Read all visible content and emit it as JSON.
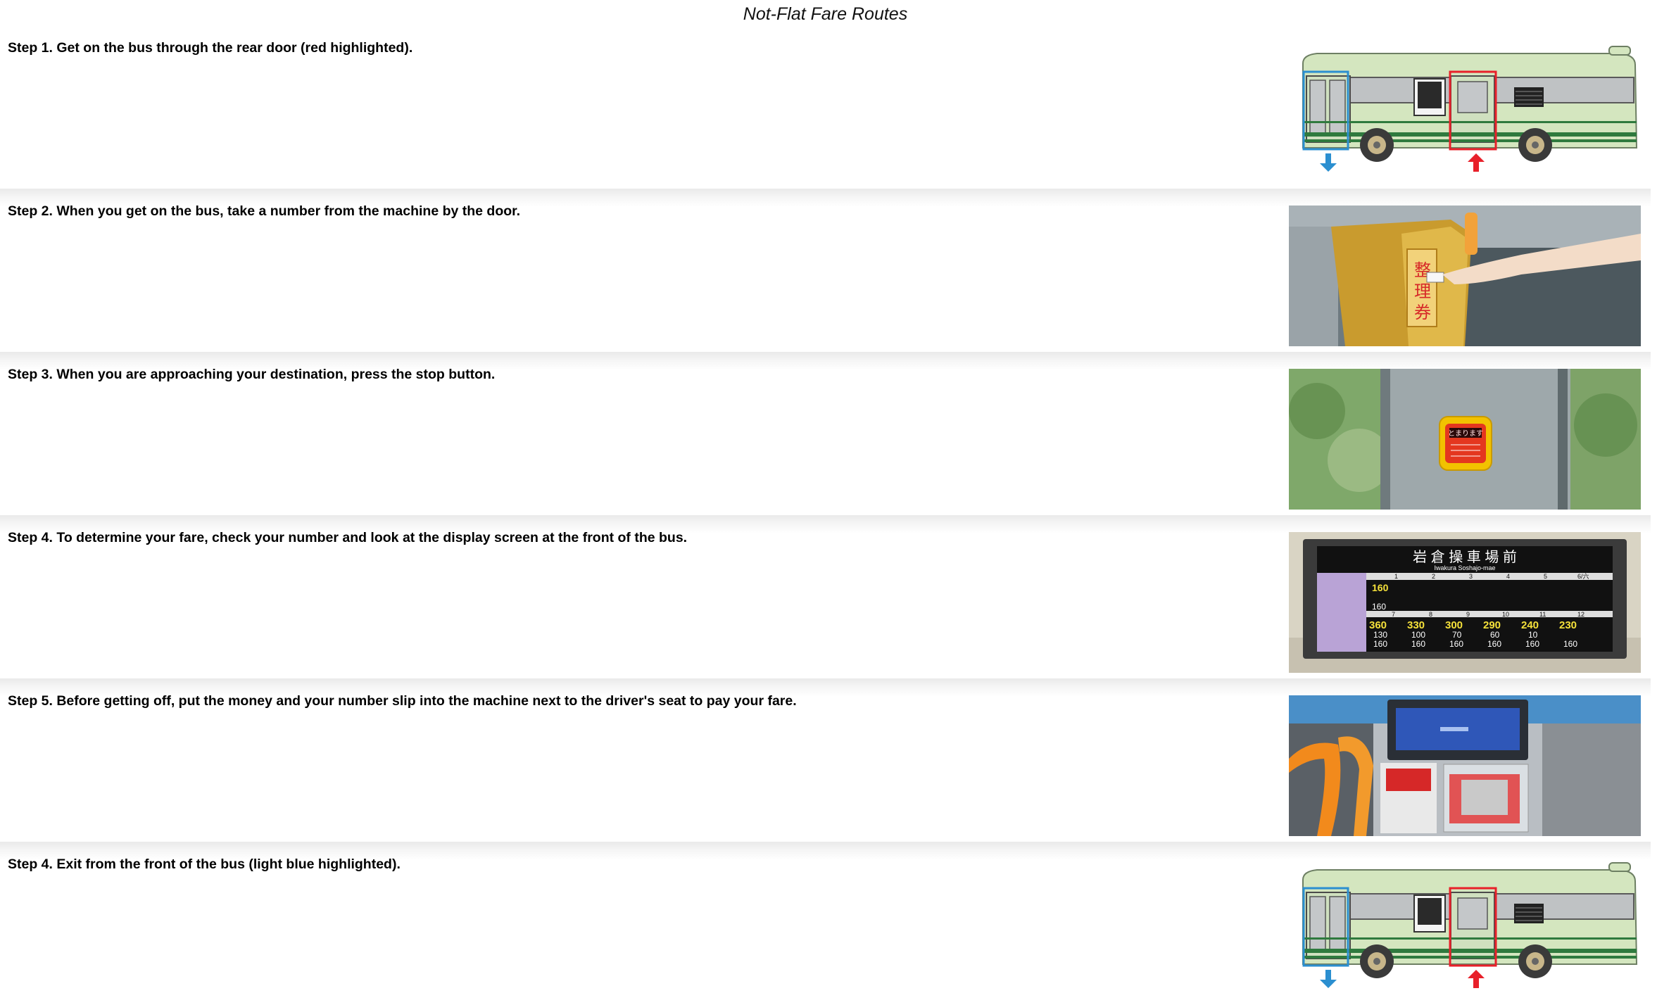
{
  "page": {
    "title": "Not-Flat Fare Routes"
  },
  "steps": [
    {
      "text": "Step 1. Get on the bus through the rear door (red highlighted).",
      "image": "bus-rear-door-illustration"
    },
    {
      "text": "Step 2. When you get on the bus, take a number from the machine by the door.",
      "image": "number-ticket-machine-photo"
    },
    {
      "text": "Step 3. When you are approaching your destination, press the stop button.",
      "image": "stop-button-photo"
    },
    {
      "text": "Step 4. To determine your fare, check your number and look at the display screen at the front of the bus.",
      "image": "fare-display-screen-photo"
    },
    {
      "text": "Step 5. Before getting off, put the money and your number slip into the machine next to the driver's seat to pay your fare.",
      "image": "fare-box-machine-photo"
    },
    {
      "text": "Step 4. Exit from the front of the bus (light blue highlighted).",
      "image": "bus-front-door-illustration"
    }
  ],
  "images": {
    "ticket_machine": {
      "label_chars": [
        "整",
        "理",
        "券"
      ]
    },
    "stop_button": {
      "label": "とまります"
    },
    "fare_display": {
      "stop_name": "岩 倉 操 車 場 前",
      "stop_name_romaji": "Iwakura Soshajo-mae",
      "header_numbers": [
        "1",
        "2",
        "3",
        "4",
        "5",
        "6/六"
      ],
      "row1_value": "160",
      "row2_value": "160",
      "header_numbers_2": [
        "7",
        "8",
        "9",
        "10",
        "11",
        "12"
      ],
      "adult_fares": [
        "360",
        "330",
        "300",
        "290",
        "240",
        "230"
      ],
      "child_fares": [
        "130",
        "100",
        "70",
        "60",
        "10"
      ],
      "pass_fares": [
        "160",
        "160",
        "160",
        "160",
        "160",
        "160"
      ]
    }
  },
  "colors": {
    "rear_door_highlight": "#e8202a",
    "front_door_highlight": "#2b8fd0",
    "bus_body": "#d4e6bf",
    "bus_stripe": "#2f7a3e"
  }
}
